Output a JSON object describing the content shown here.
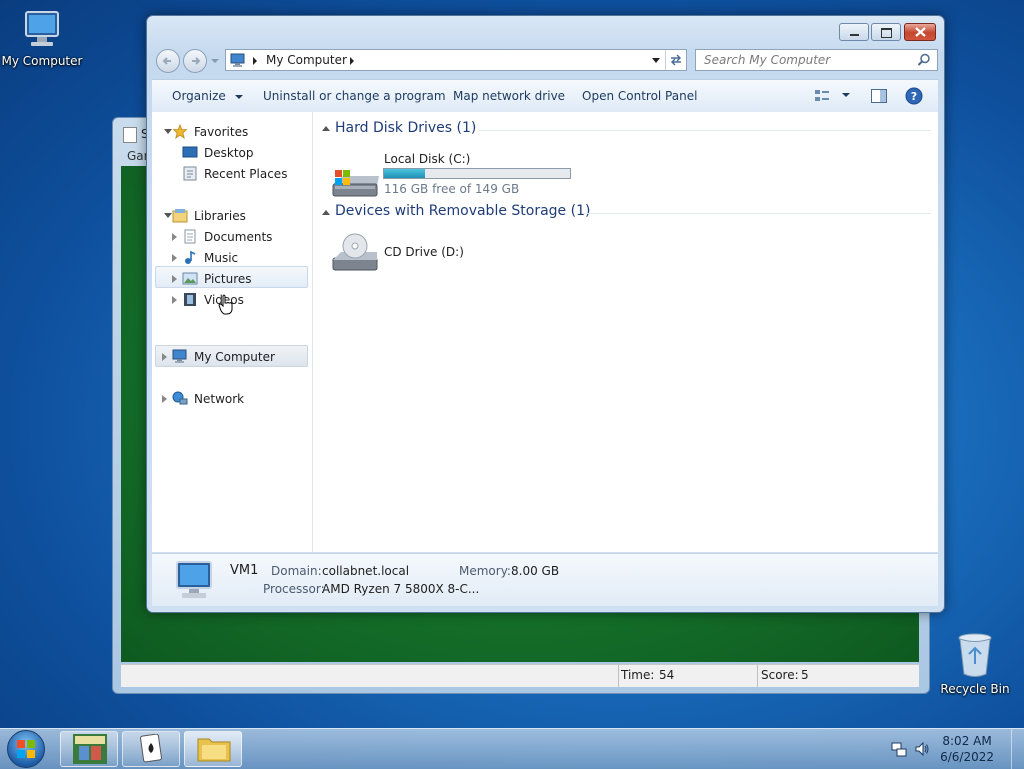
{
  "desktop": {
    "icons": [
      {
        "label": "My Computer",
        "icon": "computer-icon"
      },
      {
        "label": "Recycle Bin",
        "icon": "recycle-bin-icon"
      }
    ]
  },
  "solitaire": {
    "title_partial": "S",
    "menu_partial": "Gar",
    "time_label": "Time:",
    "time_value": "54",
    "score_label": "Score:",
    "score_value": "5"
  },
  "explorer": {
    "address": {
      "root_icon": "computer-icon",
      "crumb": "My Computer"
    },
    "search_placeholder": "Search My Computer",
    "toolbar": {
      "organize": "Organize",
      "uninstall": "Uninstall or change a program",
      "map_drive": "Map network drive",
      "control_panel": "Open Control Panel"
    },
    "nav": {
      "favorites": "Favorites",
      "desktop": "Desktop",
      "recent": "Recent Places",
      "libraries": "Libraries",
      "documents": "Documents",
      "music": "Music",
      "pictures": "Pictures",
      "videos": "Videos",
      "my_computer": "My Computer",
      "network": "Network"
    },
    "groups": {
      "hdd": "Hard Disk Drives (1)",
      "removable": "Devices with Removable Storage (1)"
    },
    "drives": {
      "local": {
        "name": "Local Disk (C:)",
        "free_text": "116 GB free of 149 GB",
        "used_fraction": 0.22
      },
      "cd": {
        "name": "CD Drive (D:)"
      }
    },
    "details": {
      "name": "VM1",
      "domain_label": "Domain:",
      "domain_value": "collabnet.local",
      "memory_label": "Memory:",
      "memory_value": "8.00 GB",
      "processor_label": "Processor:",
      "processor_value": "AMD Ryzen 7 5800X 8-C..."
    }
  },
  "taskbar": {
    "time": "8:02 AM",
    "date": "6/6/2022"
  }
}
